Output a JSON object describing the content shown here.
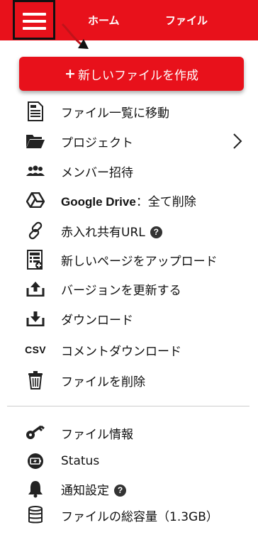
{
  "header": {
    "home_label": "ホーム",
    "file_label": "ファイル"
  },
  "create_button": {
    "plus": "+",
    "label": "新しいファイルを作成"
  },
  "menu": {
    "move_to_list": "ファイル一覧に移動",
    "project": "プロジェクト",
    "invite_members": "メンバー招待",
    "google_drive_brand": "Google Drive",
    "google_drive_action": "：全て削除",
    "share_url": "赤入れ共有URL",
    "upload_pages": "新しいページをアップロード",
    "update_version": "バージョンを更新する",
    "download": "ダウンロード",
    "csv_icon_text": "CSV",
    "comment_download": "コメントダウンロード",
    "delete_file": "ファイルを削除"
  },
  "info_menu": {
    "file_info": "ファイル情報",
    "status": "Status",
    "notifications": "通知設定",
    "storage": "ファイルの総容量（1.3GB）"
  },
  "help_glyph": "?",
  "colors": {
    "brand_red": "#e8111b"
  }
}
